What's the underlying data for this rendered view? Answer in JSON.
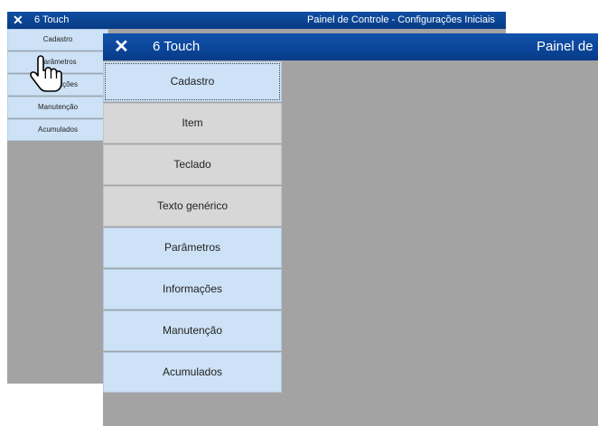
{
  "background_window": {
    "app_name": "6 Touch",
    "title": "Painel de Controle - Configurações Iniciais",
    "menu": [
      {
        "label": "Cadastro"
      },
      {
        "label": "Parâmetros"
      },
      {
        "label": "Informações"
      },
      {
        "label": "Manutenção"
      },
      {
        "label": "Acumulados"
      }
    ]
  },
  "main_window": {
    "app_name": "6 Touch",
    "title": "Painel de",
    "menu": [
      {
        "label": "Cadastro",
        "style": "blue"
      },
      {
        "label": "Item",
        "style": "gray"
      },
      {
        "label": "Teclado",
        "style": "gray"
      },
      {
        "label": "Texto genérico",
        "style": "gray"
      },
      {
        "label": "Parâmetros",
        "style": "blue"
      },
      {
        "label": "Informações",
        "style": "blue"
      },
      {
        "label": "Manutenção",
        "style": "blue"
      },
      {
        "label": "Acumulados",
        "style": "blue"
      }
    ]
  },
  "icons": {
    "close": "close-icon",
    "cursor": "hand-pointer-icon"
  },
  "colors": {
    "titlebar": "#0a4594",
    "menu_blue": "#cde2f6",
    "menu_gray": "#d7d7d7",
    "workspace": "#a3a3a3"
  }
}
